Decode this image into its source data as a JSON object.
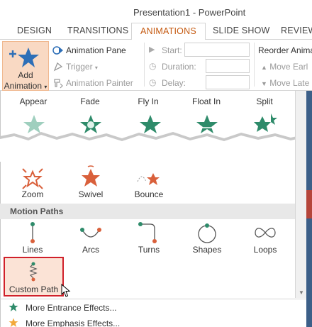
{
  "window": {
    "title": "Presentation1 - PowerPoint"
  },
  "tabs": [
    {
      "label": "DESIGN",
      "active": false
    },
    {
      "label": "TRANSITIONS",
      "active": false
    },
    {
      "label": "ANIMATIONS",
      "active": true
    },
    {
      "label": "SLIDE SHOW",
      "active": false
    },
    {
      "label": "REVIEW",
      "active": false
    }
  ],
  "ribbon": {
    "add_animation": {
      "line1": "Add",
      "line2": "Animation"
    },
    "animation_pane": "Animation Pane",
    "trigger": "Trigger",
    "animation_painter": "Animation Painter",
    "start_label": "Start:",
    "duration_label": "Duration:",
    "delay_label": "Delay:",
    "reorder_label": "Reorder Anima",
    "move_earlier": "Move Earl",
    "move_later": "Move Late"
  },
  "entrance_row": [
    "Appear",
    "Fade",
    "Fly In",
    "Float In",
    "Split"
  ],
  "emphasis_row": [
    "Zoom",
    "Swivel",
    "Bounce"
  ],
  "motion_paths": {
    "header": "Motion Paths",
    "items": [
      "Lines",
      "Arcs",
      "Turns",
      "Shapes",
      "Loops"
    ],
    "custom": "Custom Path"
  },
  "menu": {
    "more_entrance": "More Entrance Effects...",
    "more_emphasis": "More Emphasis Effects..."
  },
  "colors": {
    "accent": "#c55a11",
    "green_star": "#2e8b6a",
    "orange_star": "#d9603b",
    "blue_star": "#2e6fb7",
    "highlight_border": "#d0202a",
    "strip": "#3c5f88"
  },
  "icons": {
    "add_animation": "add-animation-star-icon",
    "animation_pane": "animation-pane-icon",
    "trigger": "trigger-icon",
    "painter": "animation-painter-icon"
  }
}
